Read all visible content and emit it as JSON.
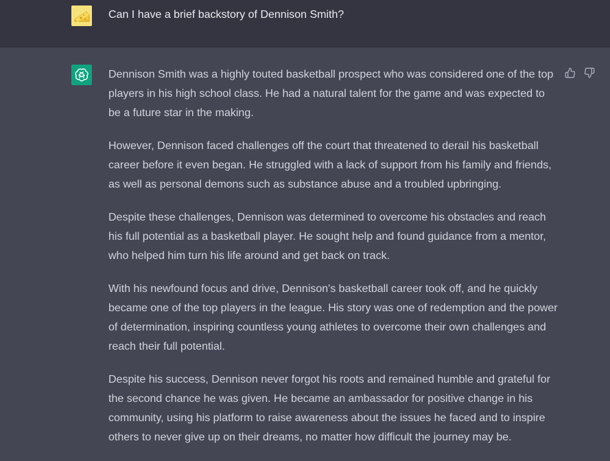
{
  "conversation": {
    "user_message": "Can I have a brief backstory of Dennison Smith?",
    "assistant_paragraphs": [
      "Dennison Smith was a highly touted basketball prospect who was considered one of the top players in his high school class. He had a natural talent for the game and was expected to be a future star in the making.",
      "However, Dennison faced challenges off the court that threatened to derail his basketball career before it even began. He struggled with a lack of support from his family and friends, as well as personal demons such as substance abuse and a troubled upbringing.",
      "Despite these challenges, Dennison was determined to overcome his obstacles and reach his full potential as a basketball player. He sought help and found guidance from a mentor, who helped him turn his life around and get back on track.",
      "With his newfound focus and drive, Dennison's basketball career took off, and he quickly became one of the top players in the league. His story was one of redemption and the power of determination, inspiring countless young athletes to overcome their own challenges and reach their full potential.",
      "Despite his success, Dennison never forgot his roots and remained humble and grateful for the second chance he was given. He became an ambassador for positive change in his community, using his platform to raise awareness about the issues he faced and to inspire others to never give up on their dreams, no matter how difficult the journey may be."
    ]
  },
  "icons": {
    "user_avatar": "cheese-avatar-icon",
    "assistant_avatar": "openai-logo-icon",
    "thumbs_up": "thumbs-up-icon",
    "thumbs_down": "thumbs-down-icon"
  },
  "colors": {
    "user_row_bg": "#343541",
    "assistant_row_bg": "#444654",
    "assistant_avatar_bg": "#10a37f",
    "text": "#d1d5db"
  }
}
